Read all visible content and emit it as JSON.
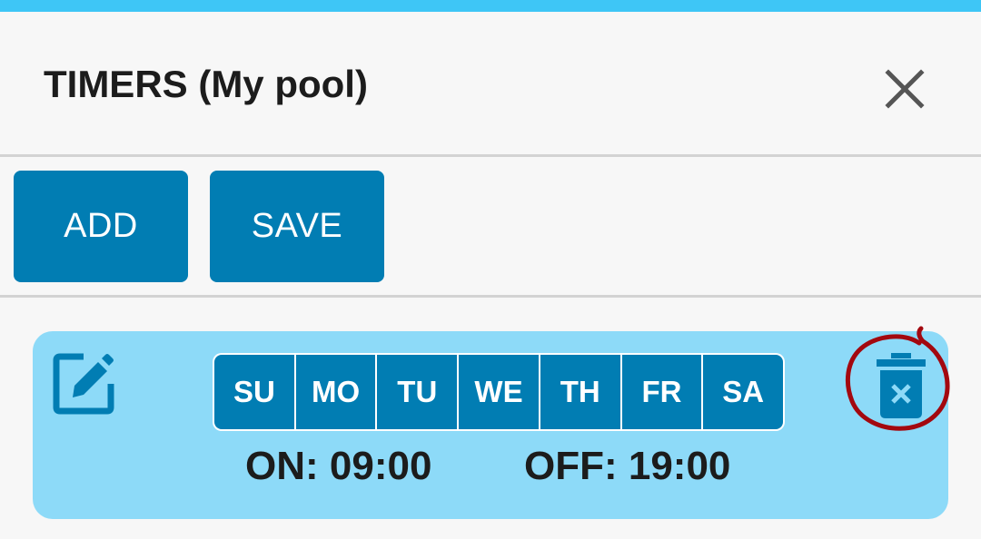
{
  "header": {
    "title": "TIMERS (My pool)",
    "close_icon": "close-icon"
  },
  "toolbar": {
    "add_label": "ADD",
    "save_label": "SAVE"
  },
  "timers": [
    {
      "edit_icon": "edit-icon",
      "delete_icon": "trash-icon",
      "days": [
        "SU",
        "MO",
        "TU",
        "WE",
        "TH",
        "FR",
        "SA"
      ],
      "on_text": "ON: 09:00",
      "off_text": "OFF: 19:00"
    }
  ],
  "colors": {
    "top_bar": "#3ec6f6",
    "primary": "#017db3",
    "card_background": "#8ddaf8",
    "annotation": "#a3080f"
  }
}
